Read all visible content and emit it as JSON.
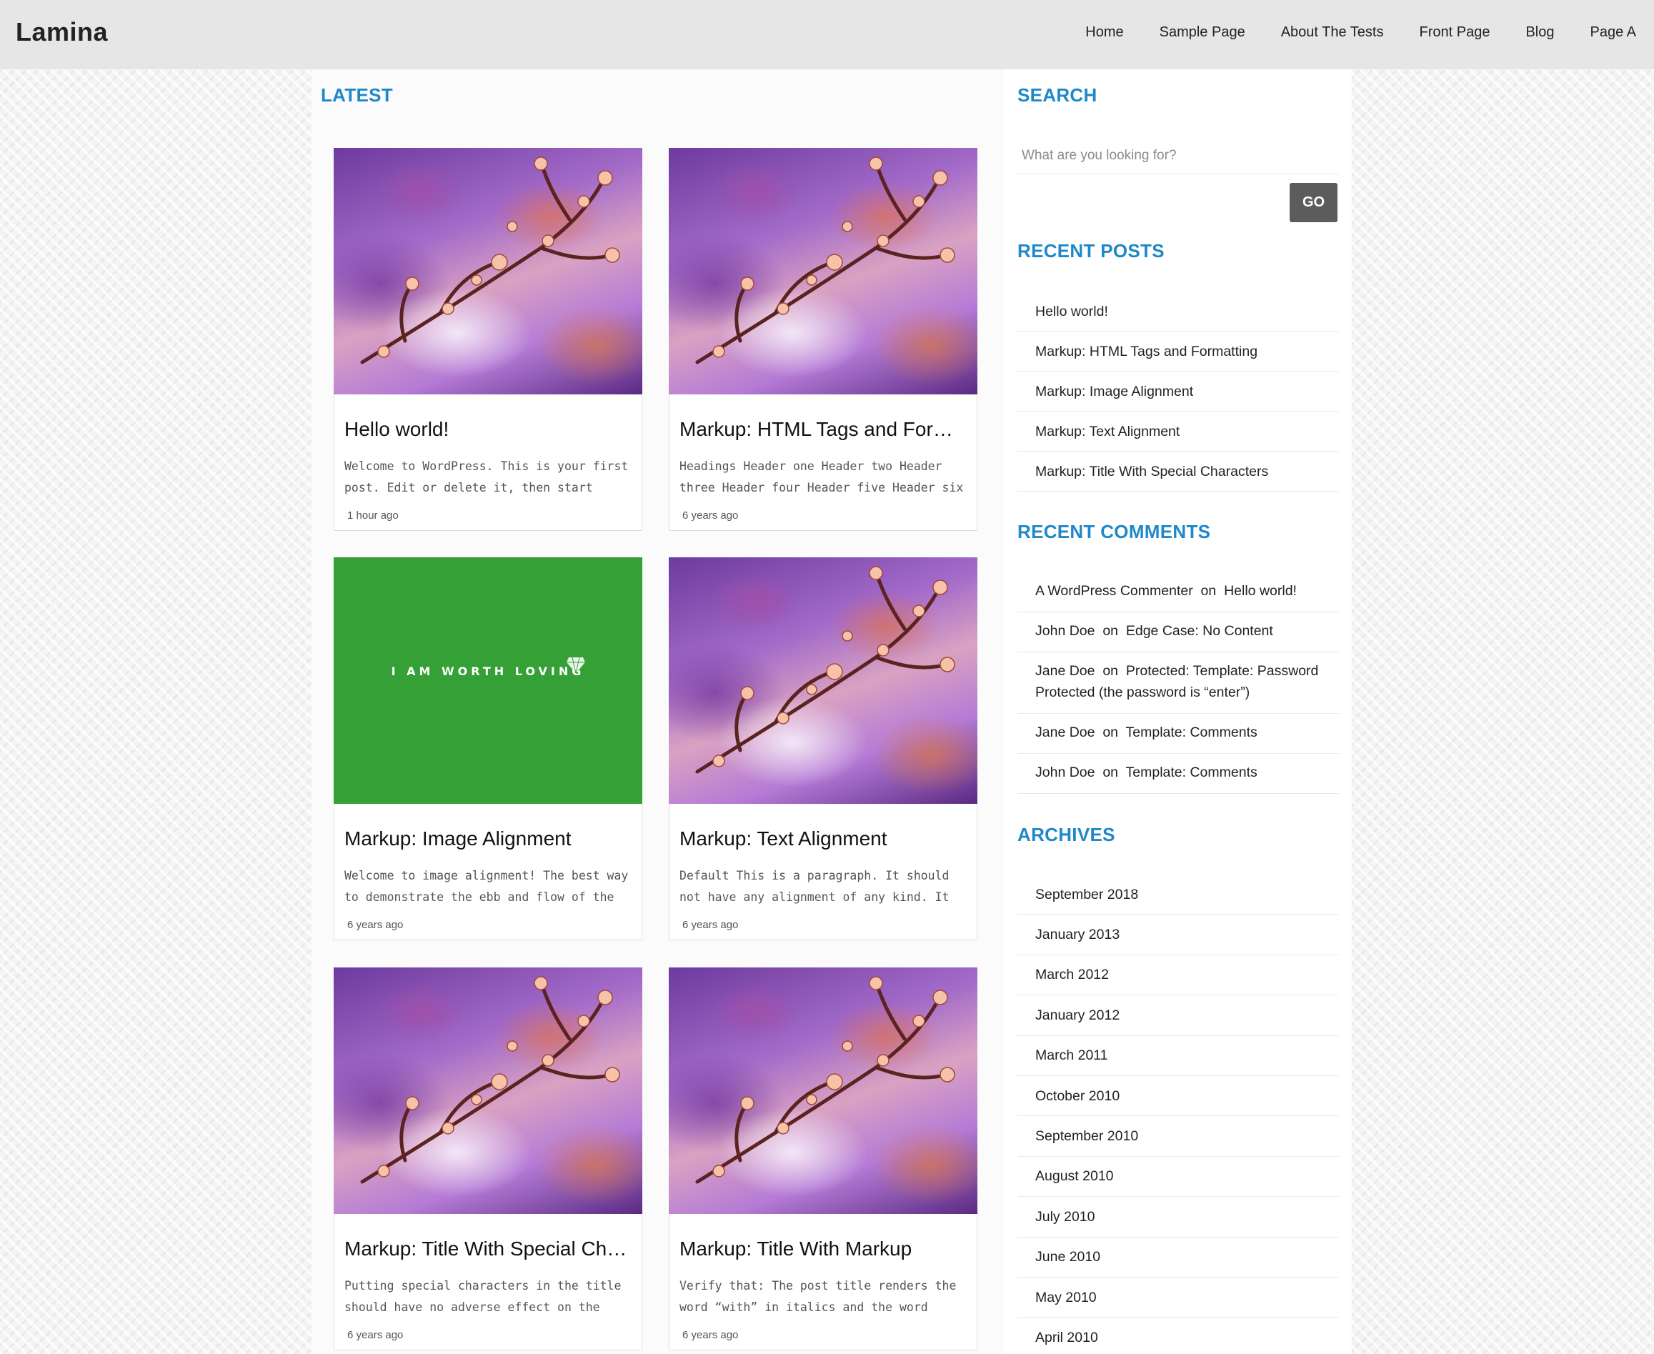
{
  "site": {
    "brand": "Lamina"
  },
  "nav": [
    {
      "label": "Home"
    },
    {
      "label": "Sample Page"
    },
    {
      "label": "About The Tests"
    },
    {
      "label": "Front Page"
    },
    {
      "label": "Blog"
    },
    {
      "label": "Page A"
    }
  ],
  "main": {
    "section_title": "LATEST",
    "posts": [
      {
        "title": "Hello world!",
        "excerpt": "Welcome to WordPress. This is your first post. Edit or delete it, then start writing!",
        "time": "1 hour ago",
        "image": "blossom"
      },
      {
        "title": "Markup: HTML Tags and Format...",
        "excerpt": "Headings Header one Header two Header three Header four Header five Header six Blockquotes",
        "time": "6 years ago",
        "image": "blossom"
      },
      {
        "title": "Markup: Image Alignment",
        "excerpt": "Welcome to image alignment! The best way to demonstrate the ebb and flow of the various",
        "time": "6 years ago",
        "image": "green",
        "image_text": "I AM WORTH LOVING"
      },
      {
        "title": "Markup: Text Alignment",
        "excerpt": "Default This is a paragraph. It should not have any alignment of any kind. It should just flow",
        "time": "6 years ago",
        "image": "blossom"
      },
      {
        "title": "Markup: Title With Special Char...",
        "excerpt": "Putting special characters in the title should have no adverse effect on the layout or",
        "time": "6 years ago",
        "image": "blossom"
      },
      {
        "title": "Markup: Title With Markup",
        "excerpt": "Verify that: The post title renders the word “with” in italics and the word “markup” in bold.",
        "time": "6 years ago",
        "image": "blossom"
      }
    ]
  },
  "sidebar": {
    "search_title": "SEARCH",
    "search_placeholder": "What are you looking for?",
    "search_button": "GO",
    "recent_posts_title": "RECENT POSTS",
    "recent_posts": [
      "Hello world!",
      "Markup: HTML Tags and Formatting",
      "Markup: Image Alignment",
      "Markup: Text Alignment",
      "Markup: Title With Special Characters"
    ],
    "recent_comments_title": "RECENT COMMENTS",
    "recent_comments": [
      {
        "author": "A WordPress Commenter",
        "on": "on",
        "post": "Hello world!"
      },
      {
        "author": "John Doe",
        "on": "on",
        "post": "Edge Case: No Content"
      },
      {
        "author": "Jane Doe",
        "on": "on",
        "post": "Protected: Template: Password Protected (the password is “enter”)"
      },
      {
        "author": "Jane Doe",
        "on": "on",
        "post": "Template: Comments"
      },
      {
        "author": "John Doe",
        "on": "on",
        "post": "Template: Comments"
      }
    ],
    "archives_title": "ARCHIVES",
    "archives": [
      "September 2018",
      "January 2013",
      "March 2012",
      "January 2012",
      "March 2011",
      "October 2010",
      "September 2010",
      "August 2010",
      "July 2010",
      "June 2010",
      "May 2010",
      "April 2010"
    ]
  },
  "colors": {
    "accent": "#1e88c9",
    "header_bg": "#e6e6e6",
    "button_bg": "#5c5c5c",
    "green_image": "#35a036"
  }
}
